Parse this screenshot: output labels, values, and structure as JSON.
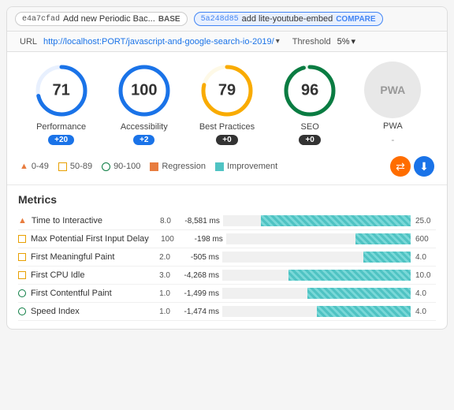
{
  "header": {
    "base_hash": "e4a7cfad",
    "base_msg": "Add new Periodic Bac...",
    "base_label": "BASE",
    "compare_hash": "5a248d85",
    "compare_msg": "add lite-youtube-embed",
    "compare_label": "COMPARE"
  },
  "urlbar": {
    "url_label": "URL",
    "url": "http://localhost:PORT/javascript-and-google-search-io-2019/",
    "threshold_label": "Threshold",
    "threshold": "5%"
  },
  "scores": [
    {
      "id": "performance",
      "value": "71",
      "label": "Performance",
      "delta": "+20",
      "delta_type": "positive",
      "color": "#1a73e8",
      "track_color": "#e8f0fe"
    },
    {
      "id": "accessibility",
      "value": "100",
      "label": "Accessibility",
      "delta": "+2",
      "delta_type": "positive",
      "color": "#1a73e8",
      "track_color": "#e8f0fe"
    },
    {
      "id": "best-practices",
      "value": "79",
      "label": "Best Practices",
      "delta": "+0",
      "delta_type": "zero",
      "color": "#f9ab00",
      "track_color": "#fef9e7"
    },
    {
      "id": "seo",
      "value": "96",
      "label": "SEO",
      "delta": "+0",
      "delta_type": "zero",
      "color": "#0a7c42",
      "track_color": "#e6f4ea"
    },
    {
      "id": "pwa",
      "value": "PWA",
      "label": "PWA",
      "delta": "-",
      "delta_type": "dash"
    }
  ],
  "legend": {
    "items": [
      {
        "id": "0-49",
        "icon": "triangle",
        "label": "0-49"
      },
      {
        "id": "50-89",
        "icon": "square",
        "label": "50-89"
      },
      {
        "id": "90-100",
        "icon": "circle",
        "label": "90-100"
      },
      {
        "id": "regression",
        "icon": "regression",
        "label": "Regression"
      },
      {
        "id": "improvement",
        "icon": "improvement",
        "label": "Improvement"
      }
    ]
  },
  "metrics": {
    "title": "Metrics",
    "rows": [
      {
        "id": "time-to-interactive",
        "icon": "triangle",
        "name": "Time to Interactive",
        "base": "8.0",
        "diff": "-8,581 ms",
        "bar_pct": 80,
        "compare": "25.0"
      },
      {
        "id": "max-first-input-delay",
        "icon": "square",
        "name": "Max Potential First Input Delay",
        "base": "100",
        "diff": "-198 ms",
        "bar_pct": 30,
        "compare": "600"
      },
      {
        "id": "first-meaningful-paint",
        "icon": "square",
        "name": "First Meaningful Paint",
        "base": "2.0",
        "diff": "-505 ms",
        "bar_pct": 25,
        "compare": "4.0"
      },
      {
        "id": "first-cpu-idle",
        "icon": "square",
        "name": "First CPU Idle",
        "base": "3.0",
        "diff": "-4,268 ms",
        "bar_pct": 65,
        "compare": "10.0"
      },
      {
        "id": "first-contentful-paint",
        "icon": "circle",
        "name": "First Contentful Paint",
        "base": "1.0",
        "diff": "-1,499 ms",
        "bar_pct": 55,
        "compare": "4.0"
      },
      {
        "id": "speed-index",
        "icon": "circle",
        "name": "Speed Index",
        "base": "1.0",
        "diff": "-1,474 ms",
        "bar_pct": 50,
        "compare": "4.0"
      }
    ]
  }
}
